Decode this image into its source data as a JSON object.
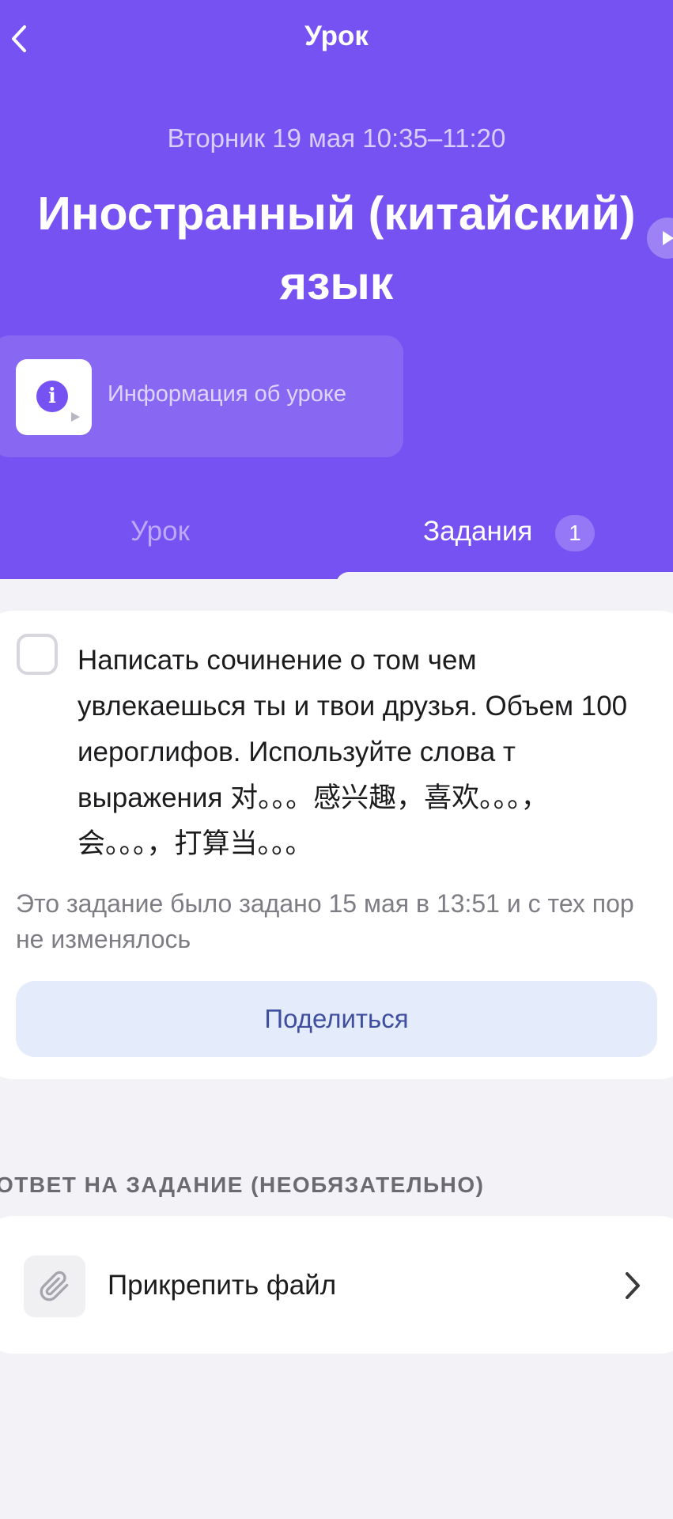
{
  "header": {
    "title": "Урок",
    "date": "Вторник 19 мая  10:35–11:20",
    "lesson_title_line1": "Иностранный (китайский)",
    "lesson_title_line2": "язык",
    "info_label": "Информация об уроке"
  },
  "tabs": [
    {
      "label": "Урок",
      "active": false
    },
    {
      "label": "Задания",
      "active": true,
      "badge": "1"
    }
  ],
  "task": {
    "text": "Написать сочинение о том чем увлекаешься ты и твои друзья. Объем 100 иероглифов. Используйте слова т выражения 对。。。感兴趣，喜欢。。。，会。。。，打算当。。。",
    "meta": "Это задание было задано 15 мая в 13:51 и с тех пор не изменялось",
    "share_label": "Поделиться"
  },
  "answer": {
    "section_title": "ОТВЕТ НА ЗАДАНИЕ (НЕОБЯЗАТЕЛЬНО)",
    "attach_label": "Прикрепить файл"
  },
  "colors": {
    "accent": "#7752f2",
    "share_bg": "#e4ebfb",
    "share_text": "#3d4f9e",
    "background": "#f2f2f7"
  }
}
